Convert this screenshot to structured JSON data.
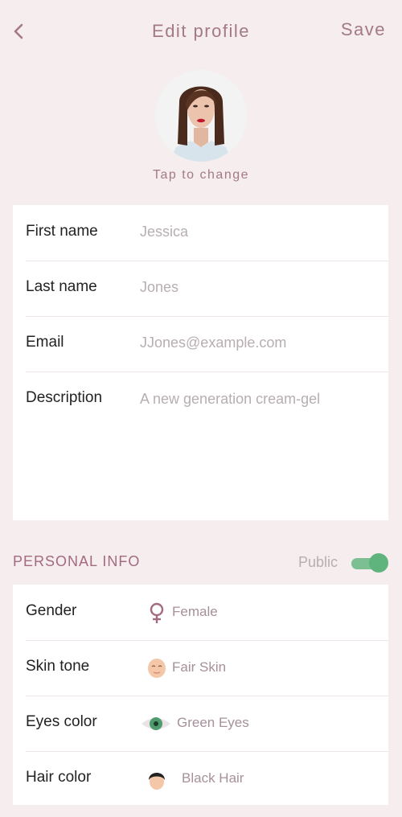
{
  "header": {
    "title": "Edit profile",
    "save_label": "Save"
  },
  "avatar": {
    "tap_label": "Tap to change"
  },
  "fields": [
    {
      "label": "First name",
      "value": "Jessica"
    },
    {
      "label": "Last name",
      "value": "Jones"
    },
    {
      "label": "Email",
      "value": "JJones@example.com"
    },
    {
      "label": "Description",
      "value": "A new generation cream-gel"
    }
  ],
  "personal_info": {
    "title": "PERSONAL INFO",
    "public_label": "Public",
    "public_enabled": true,
    "items": [
      {
        "label": "Gender",
        "value": "Female",
        "icon": "female-icon"
      },
      {
        "label": "Skin tone",
        "value": "Fair Skin",
        "icon": "face-icon"
      },
      {
        "label": "Eyes color",
        "value": "Green Eyes",
        "icon": "eye-icon"
      },
      {
        "label": "Hair color",
        "value": "Black Hair",
        "icon": "hair-icon"
      }
    ]
  },
  "colors": {
    "accent": "#a37986",
    "toggle_on": "#5fb37d",
    "background": "#f6edee"
  }
}
